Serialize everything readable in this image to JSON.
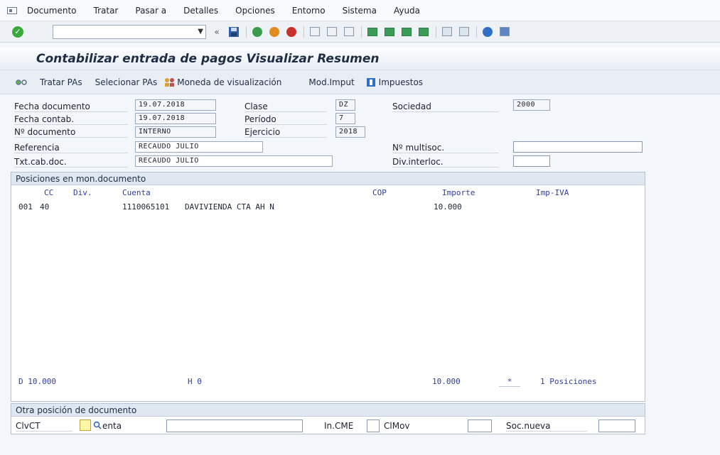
{
  "menubar": {
    "items": [
      "Documento",
      "Tratar",
      "Pasar a",
      "Detalles",
      "Opciones",
      "Entorno",
      "Sistema",
      "Ayuda"
    ]
  },
  "toolbar": {
    "command_value": "",
    "icons": [
      "enter-icon",
      "back-icon",
      "save-icon",
      "exit-icon",
      "cancel-icon",
      "print-icon",
      "find-icon",
      "find-next-icon",
      "first-page-icon",
      "prev-page-icon",
      "next-page-icon",
      "last-page-icon",
      "create-session-icon",
      "shortcut-icon",
      "help-icon",
      "layout-icon"
    ]
  },
  "title": "Contabilizar entrada de pagos Visualizar Resumen",
  "app_toolbar": {
    "tratar_pas": "Tratar PAs",
    "seleccionar_pas": "Selecionar PAs",
    "moneda": "Moneda de visualización",
    "mod_imput": "Mod.Imput",
    "impuestos": "Impuestos"
  },
  "header": {
    "fecha_documento_label": "Fecha documento",
    "fecha_documento_value": "19.07.2018",
    "fecha_contab_label": "Fecha contab.",
    "fecha_contab_value": "19.07.2018",
    "no_documento_label": "Nº documento",
    "no_documento_value": "INTERNO",
    "referencia_label": "Referencia",
    "referencia_value": "RECAUDO JULIO",
    "txt_cab_label": "Txt.cab.doc.",
    "txt_cab_value": "RECAUDO JULIO",
    "clase_label": "Clase",
    "clase_value": "DZ",
    "periodo_label": "Período",
    "periodo_value": "7",
    "ejercicio_label": "Ejercicio",
    "ejercicio_value": "2018",
    "sociedad_label": "Sociedad",
    "sociedad_value": "2000",
    "multisoc_label": "Nº multisoc.",
    "multisoc_value": "",
    "div_interloc_label": "Div.interloc.",
    "div_interloc_value": ""
  },
  "positions": {
    "title": "Posiciones en mon.documento",
    "headers": {
      "cc": "CC",
      "div": "Div.",
      "cuenta": "Cuenta",
      "cop": "COP",
      "importe": "Importe",
      "imp_iva": "Imp-IVA"
    },
    "rows": [
      {
        "cc": "001",
        "div": "40",
        "cuenta": "1110065101",
        "desc": "DAVIVIENDA CTA AH N",
        "importe": "10.000"
      }
    ],
    "footer": {
      "debe": "D 10.000",
      "haber": "H 0",
      "total": "10.000",
      "marker": "*",
      "posiciones": "1 Posiciones"
    }
  },
  "other_position": {
    "title": "Otra posición de documento",
    "clvct_label": "ClvCT",
    "cuenta_label": "enta",
    "cuenta_value": "",
    "in_cme_label": "In.CME",
    "in_cme_value": "",
    "clmov_label": "ClMov",
    "clmov_value": "",
    "soc_nueva_label": "Soc.nueva",
    "soc_nueva_value": ""
  }
}
